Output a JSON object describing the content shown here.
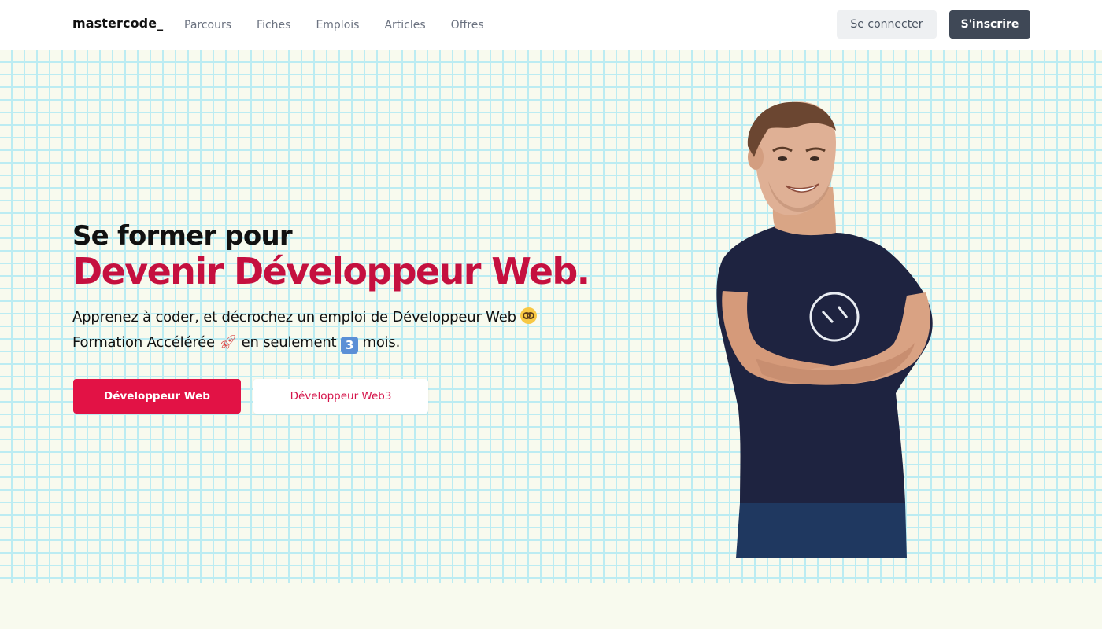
{
  "brand": {
    "logo": "mastercode_"
  },
  "nav": {
    "items": [
      "Parcours",
      "Fiches",
      "Emplois",
      "Articles",
      "Offres"
    ]
  },
  "auth": {
    "login_label": "Se connecter",
    "signup_label": "S'inscrire"
  },
  "hero": {
    "title_line1": "Se former pour",
    "title_line2": "Devenir Développeur Web.",
    "lead_line1": "Apprenez à coder, et décrochez un emploi de Développeur Web",
    "lead_line2_a": "Formation Accélérée",
    "lead_line2_b": "en seulement",
    "lead_line2_c": "mois.",
    "three_digit": "3",
    "cta_primary": "Développeur Web",
    "cta_secondary": "Développeur Web3"
  },
  "colors": {
    "accent": "#e21245",
    "title_accent": "#c5103f",
    "signup_bg": "#3f4856",
    "grid_line": "#bcecf2",
    "page_bg": "#f8faee"
  },
  "icons": [
    "nerd-face-emoji-icon",
    "rocket-emoji-icon",
    "keycap-three-emoji-icon"
  ]
}
